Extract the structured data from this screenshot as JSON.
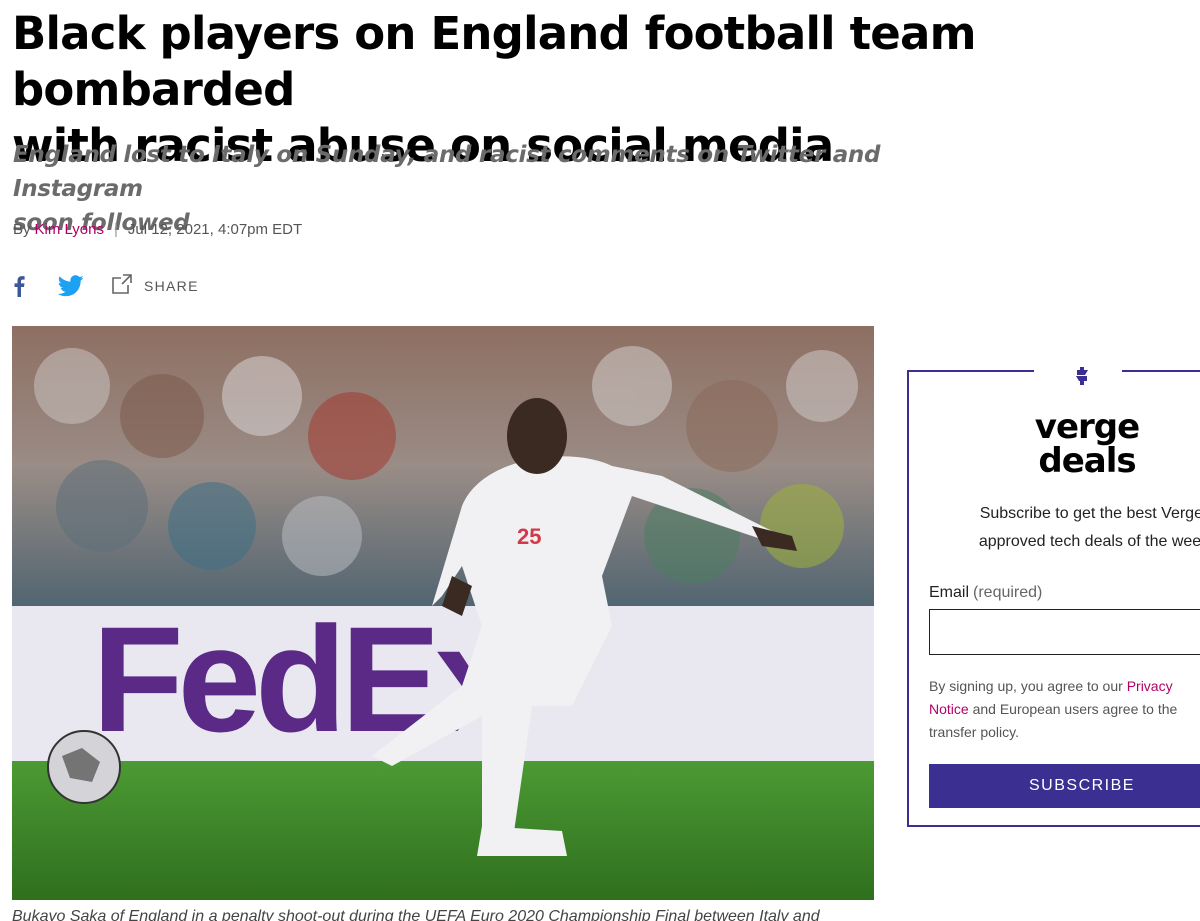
{
  "article": {
    "headline_line1": "Black players on England football team bombarded",
    "headline_line2": "with racist abuse on social media",
    "dek_line1": "England lost to Italy on Sunday, and racist comments on Twitter and Instagram",
    "dek_line2": "soon followed",
    "byline_prefix": "By",
    "author": "Kim Lyons",
    "separator": "|",
    "date": "Jul 12, 2021, 4:07pm EDT",
    "caption": "Bukayo Saka of England in a penalty shoot-out during the UEFA Euro 2020 Championship Final between Italy and"
  },
  "social": {
    "facebook_icon": "facebook-icon",
    "twitter_icon": "twitter-icon",
    "share_icon": "share-icon",
    "share_label": "SHARE"
  },
  "hero": {
    "board_text": "FedEx",
    "shirt_number": "25"
  },
  "promo": {
    "icon": "dollar-icon",
    "logo_line1": "verge",
    "logo_line2": "deals",
    "text_line1": "Subscribe to get the best Verge-",
    "text_line2": "approved tech deals of the week",
    "email_label": "Email",
    "email_required": "(required)",
    "email_value": "",
    "legal_prefix": "By signing up, you agree to our ",
    "legal_link_line1": "Privacy",
    "legal_link_line2": "Notice",
    "legal_mid": " and European users agree to the",
    "legal_suffix": "transfer policy.",
    "subscribe_label": "SUBSCRIBE"
  },
  "colors": {
    "accent_link": "#b30067",
    "promo_purple": "#3b2f92",
    "facebook_blue": "#3b5998",
    "twitter_blue": "#1da1f2"
  }
}
